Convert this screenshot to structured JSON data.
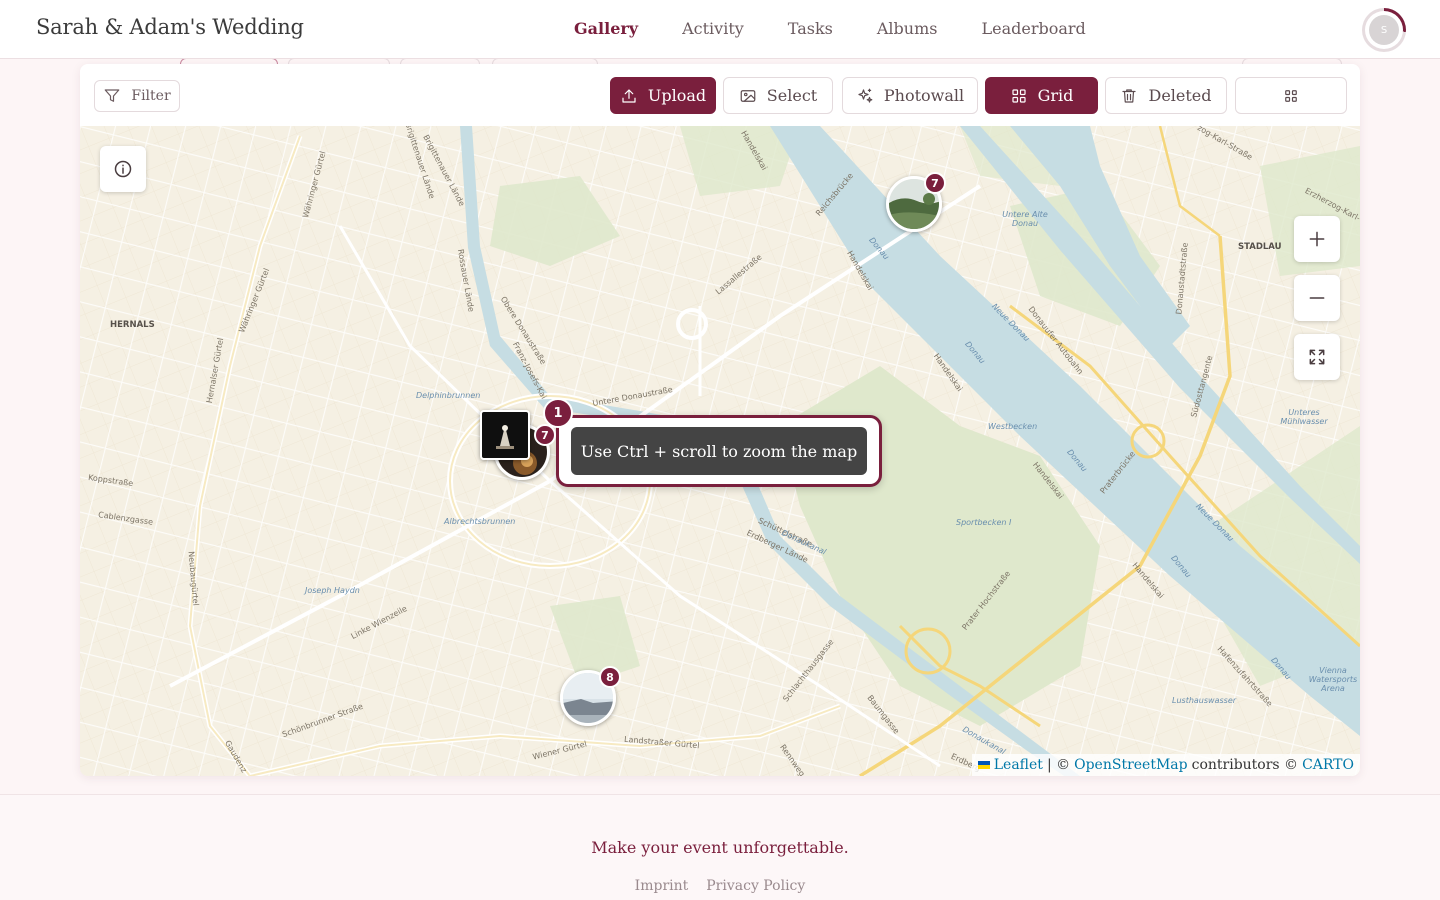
{
  "header": {
    "brand": "Sarah & Adam's Wedding",
    "nav": [
      {
        "label": "Gallery",
        "active": true
      },
      {
        "label": "Activity",
        "active": false
      },
      {
        "label": "Tasks",
        "active": false
      },
      {
        "label": "Albums",
        "active": false
      },
      {
        "label": "Leaderboard",
        "active": false
      }
    ],
    "avatar_initial": "S"
  },
  "toolbar": {
    "filter_label": "Filter",
    "upload_label": "Upload",
    "select_label": "Select",
    "photowall_label": "Photowall",
    "grid_label": "Grid",
    "deleted_label": "Deleted"
  },
  "map": {
    "zoom_hint": "Use Ctrl + scroll to zoom the map",
    "clusters": [
      {
        "count": "7"
      },
      {
        "count": "1"
      },
      {
        "count": "7"
      },
      {
        "count": "8"
      }
    ],
    "labels": {
      "hernals": "HERNALS",
      "stadlau": "STADLAU",
      "delphinbrunnen": "Delphinbrunnen",
      "albrechtsbrunnen": "Albrechtsbrunnen",
      "joseph_haydn": "Joseph Haydn",
      "koppstrasse": "Koppstraße",
      "cablenzgasse": "Cablenzgasse",
      "wiener_guertel": "Wiener Gürtel",
      "landstrasser_guertel": "Landstraßer Gürtel",
      "linke_wienzeile": "Linke Wienzeile",
      "obere_donaustrasse": "Obere Donaustraße",
      "untere_donaustrasse": "Untere Donaustraße",
      "lassallestrasse": "Lassallestraße",
      "handelskai": "Handelskai",
      "donau": "Donau",
      "neue_donau": "Neue Donau",
      "praterbruecke": "Praterbrücke",
      "westbecken": "Westbecken",
      "sportbecken": "Sportbecken I",
      "reichsbruecke": "Reichsbrücke",
      "donauufer_autobahn": "Donauufer Autobahn",
      "untere_alte_donau": "Untere Alte Donau",
      "unteres_muehlwasser": "Unteres Mühlwasser",
      "lusthauswasser": "Lusthauswasser",
      "vienna_watersports": "Vienna Watersports Arena",
      "schuettelstrasse": "Schüttelstraße",
      "erdberger_laende": "Erdberger Lände",
      "prater_hochstrasse": "Prater Hochstraße",
      "donaukanal": "Donaukanal",
      "schlachthausgasse": "Schlachthausgasse",
      "baumgasse": "Baumgasse",
      "rennweg": "Rennweg",
      "schoenbrunner_strasse": "Schönbrunner Straße",
      "neubaugurtel": "Neubaugürtel",
      "hernalser_guertel": "Hernalser Gürtel",
      "waehringer_guertel": "Währinger Gürtel",
      "rossauer_laende": "Rossauer Lände",
      "brigittenauer_laende": "Brigittenauer Lände",
      "franz_josefs_kai": "Franz-Josefs-Kai",
      "donaustadtstrasse": "Donaustadtstraße",
      "suedosttangente": "Südosttangente",
      "erzherzog_karl": "Erzherzog-Karl-",
      "zog_karl_strasse": "zog-Karl-Straße",
      "handelskai_small": "Handelskai",
      "gaudenz": "Gaudenz",
      "erdberg": "Erdberg",
      "hafenzufahrtstrasse": "Hafenzufahrtstraße"
    },
    "attribution": {
      "leaflet": "Leaflet",
      "sep": "| ©",
      "osm": "OpenStreetMap",
      "contributors": "contributors ©",
      "carto": "CARTO"
    },
    "colors": {
      "land": "#f5f0e3",
      "water": "#c6dde3",
      "park": "#dfe8cc",
      "motorway": "#f5d67a",
      "accent": "#7a1f3d"
    }
  },
  "footer": {
    "tagline": "Make your event unforgettable.",
    "imprint": "Imprint",
    "privacy": "Privacy Policy"
  }
}
